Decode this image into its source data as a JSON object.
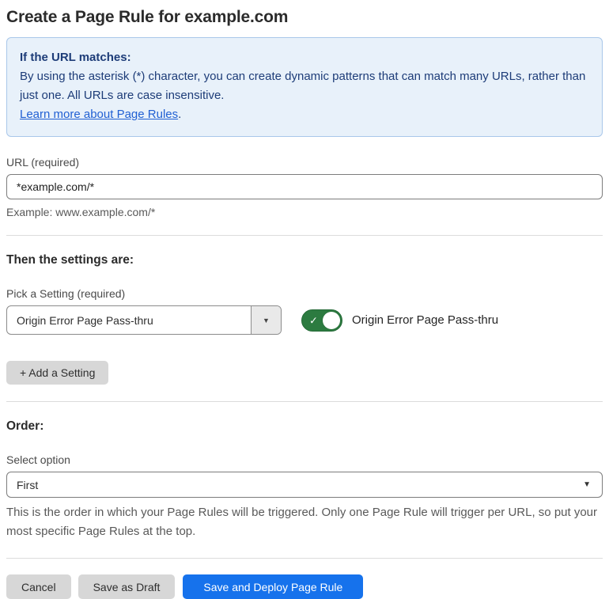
{
  "page": {
    "title": "Create a Page Rule for example.com"
  },
  "info_box": {
    "heading": "If the URL matches:",
    "body": "By using the asterisk (*) character, you can create dynamic patterns that can match many URLs, rather than just one. All URLs are case insensitive.",
    "link": "Learn more about Page Rules",
    "link_suffix": "."
  },
  "url_field": {
    "label": "URL (required)",
    "value": "*example.com/*",
    "example": "Example: www.example.com/*"
  },
  "settings_section": {
    "heading": "Then the settings are:",
    "pick_label": "Pick a Setting (required)",
    "selected_setting": "Origin Error Page Pass-thru",
    "toggle_label": "Origin Error Page Pass-thru",
    "toggle_state": "on",
    "add_button_label": "+ Add a Setting"
  },
  "order_section": {
    "heading": "Order:",
    "select_label": "Select option",
    "selected_option": "First",
    "description": "This is the order in which your Page Rules will be triggered. Only one Page Rule will trigger per URL, so put your most specific Page Rules at the top."
  },
  "footer": {
    "cancel_label": "Cancel",
    "save_draft_label": "Save as Draft",
    "save_deploy_label": "Save and Deploy Page Rule"
  },
  "icons": {
    "setting_dropdown_caret": "▼",
    "order_select_caret": "▼",
    "toggle_check": "✓"
  },
  "colors": {
    "primary_blue": "#1672ec",
    "toggle_green": "#2c7b40",
    "info_background": "#e8f1fa",
    "info_border": "#a9c7ea",
    "info_text": "#1d3c78",
    "link_blue": "#2160d3",
    "button_gray": "#d7d7d7"
  }
}
